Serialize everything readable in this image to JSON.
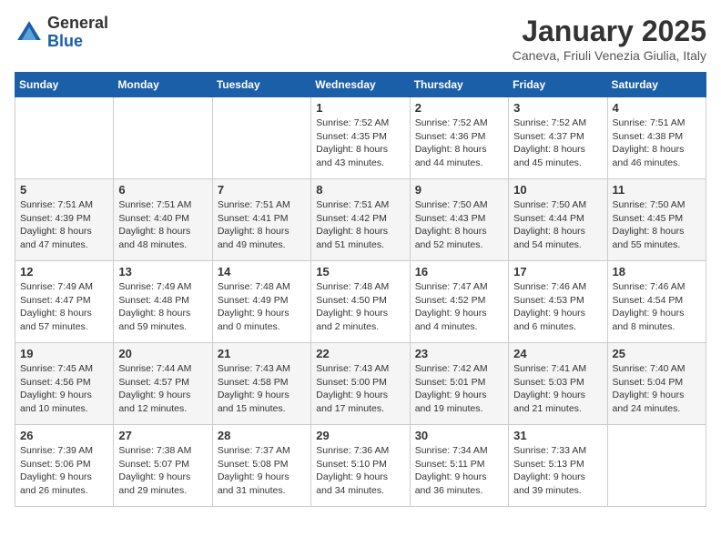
{
  "header": {
    "logo_general": "General",
    "logo_blue": "Blue",
    "title": "January 2025",
    "location": "Caneva, Friuli Venezia Giulia, Italy"
  },
  "days_of_week": [
    "Sunday",
    "Monday",
    "Tuesday",
    "Wednesday",
    "Thursday",
    "Friday",
    "Saturday"
  ],
  "weeks": [
    [
      {
        "day": "",
        "sunrise": "",
        "sunset": "",
        "daylight": ""
      },
      {
        "day": "",
        "sunrise": "",
        "sunset": "",
        "daylight": ""
      },
      {
        "day": "",
        "sunrise": "",
        "sunset": "",
        "daylight": ""
      },
      {
        "day": "1",
        "sunrise": "Sunrise: 7:52 AM",
        "sunset": "Sunset: 4:35 PM",
        "daylight": "Daylight: 8 hours and 43 minutes."
      },
      {
        "day": "2",
        "sunrise": "Sunrise: 7:52 AM",
        "sunset": "Sunset: 4:36 PM",
        "daylight": "Daylight: 8 hours and 44 minutes."
      },
      {
        "day": "3",
        "sunrise": "Sunrise: 7:52 AM",
        "sunset": "Sunset: 4:37 PM",
        "daylight": "Daylight: 8 hours and 45 minutes."
      },
      {
        "day": "4",
        "sunrise": "Sunrise: 7:51 AM",
        "sunset": "Sunset: 4:38 PM",
        "daylight": "Daylight: 8 hours and 46 minutes."
      }
    ],
    [
      {
        "day": "5",
        "sunrise": "Sunrise: 7:51 AM",
        "sunset": "Sunset: 4:39 PM",
        "daylight": "Daylight: 8 hours and 47 minutes."
      },
      {
        "day": "6",
        "sunrise": "Sunrise: 7:51 AM",
        "sunset": "Sunset: 4:40 PM",
        "daylight": "Daylight: 8 hours and 48 minutes."
      },
      {
        "day": "7",
        "sunrise": "Sunrise: 7:51 AM",
        "sunset": "Sunset: 4:41 PM",
        "daylight": "Daylight: 8 hours and 49 minutes."
      },
      {
        "day": "8",
        "sunrise": "Sunrise: 7:51 AM",
        "sunset": "Sunset: 4:42 PM",
        "daylight": "Daylight: 8 hours and 51 minutes."
      },
      {
        "day": "9",
        "sunrise": "Sunrise: 7:50 AM",
        "sunset": "Sunset: 4:43 PM",
        "daylight": "Daylight: 8 hours and 52 minutes."
      },
      {
        "day": "10",
        "sunrise": "Sunrise: 7:50 AM",
        "sunset": "Sunset: 4:44 PM",
        "daylight": "Daylight: 8 hours and 54 minutes."
      },
      {
        "day": "11",
        "sunrise": "Sunrise: 7:50 AM",
        "sunset": "Sunset: 4:45 PM",
        "daylight": "Daylight: 8 hours and 55 minutes."
      }
    ],
    [
      {
        "day": "12",
        "sunrise": "Sunrise: 7:49 AM",
        "sunset": "Sunset: 4:47 PM",
        "daylight": "Daylight: 8 hours and 57 minutes."
      },
      {
        "day": "13",
        "sunrise": "Sunrise: 7:49 AM",
        "sunset": "Sunset: 4:48 PM",
        "daylight": "Daylight: 8 hours and 59 minutes."
      },
      {
        "day": "14",
        "sunrise": "Sunrise: 7:48 AM",
        "sunset": "Sunset: 4:49 PM",
        "daylight": "Daylight: 9 hours and 0 minutes."
      },
      {
        "day": "15",
        "sunrise": "Sunrise: 7:48 AM",
        "sunset": "Sunset: 4:50 PM",
        "daylight": "Daylight: 9 hours and 2 minutes."
      },
      {
        "day": "16",
        "sunrise": "Sunrise: 7:47 AM",
        "sunset": "Sunset: 4:52 PM",
        "daylight": "Daylight: 9 hours and 4 minutes."
      },
      {
        "day": "17",
        "sunrise": "Sunrise: 7:46 AM",
        "sunset": "Sunset: 4:53 PM",
        "daylight": "Daylight: 9 hours and 6 minutes."
      },
      {
        "day": "18",
        "sunrise": "Sunrise: 7:46 AM",
        "sunset": "Sunset: 4:54 PM",
        "daylight": "Daylight: 9 hours and 8 minutes."
      }
    ],
    [
      {
        "day": "19",
        "sunrise": "Sunrise: 7:45 AM",
        "sunset": "Sunset: 4:56 PM",
        "daylight": "Daylight: 9 hours and 10 minutes."
      },
      {
        "day": "20",
        "sunrise": "Sunrise: 7:44 AM",
        "sunset": "Sunset: 4:57 PM",
        "daylight": "Daylight: 9 hours and 12 minutes."
      },
      {
        "day": "21",
        "sunrise": "Sunrise: 7:43 AM",
        "sunset": "Sunset: 4:58 PM",
        "daylight": "Daylight: 9 hours and 15 minutes."
      },
      {
        "day": "22",
        "sunrise": "Sunrise: 7:43 AM",
        "sunset": "Sunset: 5:00 PM",
        "daylight": "Daylight: 9 hours and 17 minutes."
      },
      {
        "day": "23",
        "sunrise": "Sunrise: 7:42 AM",
        "sunset": "Sunset: 5:01 PM",
        "daylight": "Daylight: 9 hours and 19 minutes."
      },
      {
        "day": "24",
        "sunrise": "Sunrise: 7:41 AM",
        "sunset": "Sunset: 5:03 PM",
        "daylight": "Daylight: 9 hours and 21 minutes."
      },
      {
        "day": "25",
        "sunrise": "Sunrise: 7:40 AM",
        "sunset": "Sunset: 5:04 PM",
        "daylight": "Daylight: 9 hours and 24 minutes."
      }
    ],
    [
      {
        "day": "26",
        "sunrise": "Sunrise: 7:39 AM",
        "sunset": "Sunset: 5:06 PM",
        "daylight": "Daylight: 9 hours and 26 minutes."
      },
      {
        "day": "27",
        "sunrise": "Sunrise: 7:38 AM",
        "sunset": "Sunset: 5:07 PM",
        "daylight": "Daylight: 9 hours and 29 minutes."
      },
      {
        "day": "28",
        "sunrise": "Sunrise: 7:37 AM",
        "sunset": "Sunset: 5:08 PM",
        "daylight": "Daylight: 9 hours and 31 minutes."
      },
      {
        "day": "29",
        "sunrise": "Sunrise: 7:36 AM",
        "sunset": "Sunset: 5:10 PM",
        "daylight": "Daylight: 9 hours and 34 minutes."
      },
      {
        "day": "30",
        "sunrise": "Sunrise: 7:34 AM",
        "sunset": "Sunset: 5:11 PM",
        "daylight": "Daylight: 9 hours and 36 minutes."
      },
      {
        "day": "31",
        "sunrise": "Sunrise: 7:33 AM",
        "sunset": "Sunset: 5:13 PM",
        "daylight": "Daylight: 9 hours and 39 minutes."
      },
      {
        "day": "",
        "sunrise": "",
        "sunset": "",
        "daylight": ""
      }
    ]
  ]
}
